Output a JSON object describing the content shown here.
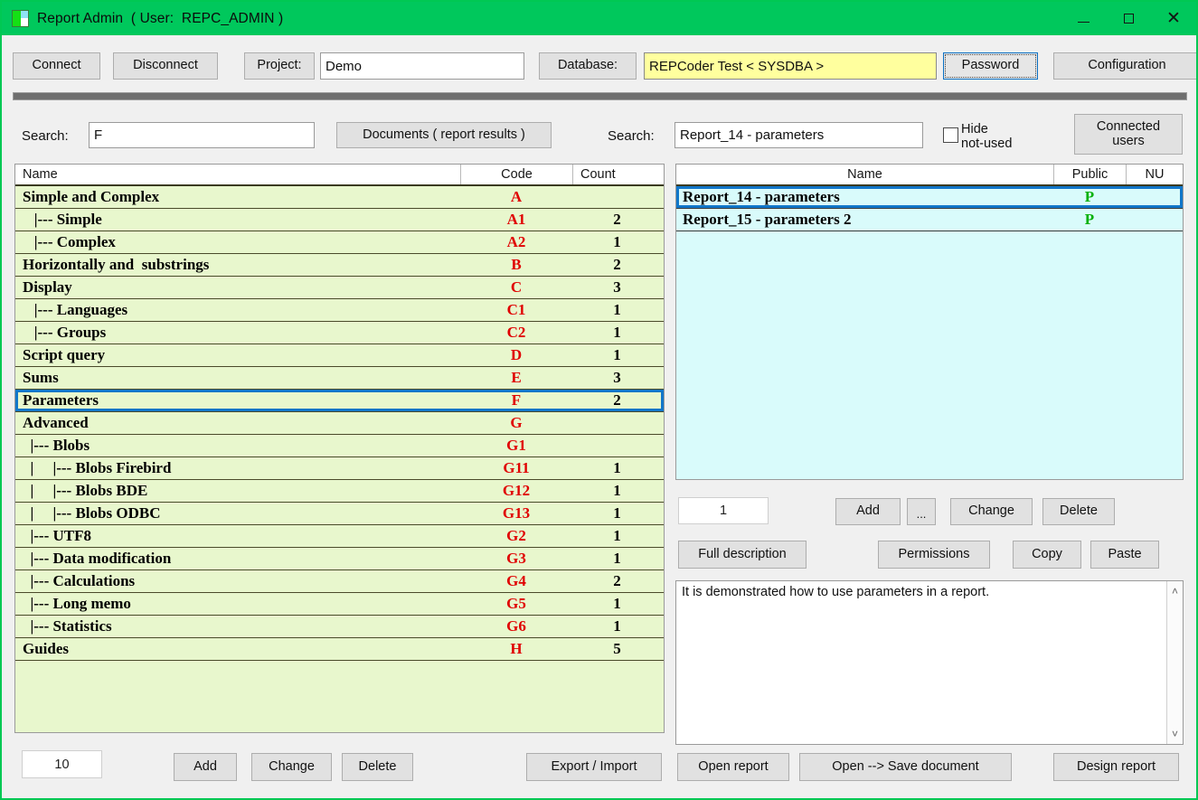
{
  "window": {
    "title": "Report Admin  ( User:  REPC_ADMIN )",
    "icon": "app-grid-icon",
    "minimize": "",
    "maximize": "",
    "close": "✕",
    "titlebar_color": "#00c85c"
  },
  "toolbar": {
    "connect": "Connect",
    "disconnect": "Disconnect",
    "project_label": "Project:",
    "project_value": "Demo",
    "database_label": "Database:",
    "database_value": "REPCoder Test < SYSDBA >",
    "password": "Password",
    "configuration": "Configuration"
  },
  "left": {
    "search_label": "Search:",
    "search_value": "F",
    "documents_button": "Documents ( report results )",
    "columns": [
      "Name",
      "Code",
      "Count"
    ],
    "sort_indicator": "ˇ",
    "rows": [
      {
        "name": "Simple and Complex",
        "code": "A",
        "count": "",
        "selected": false
      },
      {
        "name": "   |--- Simple",
        "code": "A1",
        "count": "2",
        "selected": false
      },
      {
        "name": "   |--- Complex",
        "code": "A2",
        "count": "1",
        "selected": false
      },
      {
        "name": "Horizontally and  substrings",
        "code": "B",
        "count": "2",
        "selected": false
      },
      {
        "name": "Display",
        "code": "C",
        "count": "3",
        "selected": false
      },
      {
        "name": "   |--- Languages",
        "code": "C1",
        "count": "1",
        "selected": false
      },
      {
        "name": "   |--- Groups",
        "code": "C2",
        "count": "1",
        "selected": false
      },
      {
        "name": "Script query",
        "code": "D",
        "count": "1",
        "selected": false
      },
      {
        "name": "Sums",
        "code": "E",
        "count": "3",
        "selected": false
      },
      {
        "name": "Parameters",
        "code": "F",
        "count": "2",
        "selected": true
      },
      {
        "name": "Advanced",
        "code": "G",
        "count": "",
        "selected": false
      },
      {
        "name": "  |--- Blobs",
        "code": "G1",
        "count": "",
        "selected": false
      },
      {
        "name": "  |     |--- Blobs Firebird",
        "code": "G11",
        "count": "1",
        "selected": false
      },
      {
        "name": "  |     |--- Blobs BDE",
        "code": "G12",
        "count": "1",
        "selected": false
      },
      {
        "name": "  |     |--- Blobs ODBC",
        "code": "G13",
        "count": "1",
        "selected": false
      },
      {
        "name": "  |--- UTF8",
        "code": "G2",
        "count": "1",
        "selected": false
      },
      {
        "name": "  |--- Data modification",
        "code": "G3",
        "count": "1",
        "selected": false
      },
      {
        "name": "  |--- Calculations",
        "code": "G4",
        "count": "2",
        "selected": false
      },
      {
        "name": "  |--- Long memo",
        "code": "G5",
        "count": "1",
        "selected": false
      },
      {
        "name": "  |--- Statistics",
        "code": "G6",
        "count": "1",
        "selected": false
      },
      {
        "name": "Guides",
        "code": "H",
        "count": "5",
        "selected": false
      }
    ],
    "count_value": "10",
    "add": "Add",
    "change": "Change",
    "delete": "Delete",
    "export_import": "Export / Import"
  },
  "right": {
    "search_label": "Search:",
    "search_value": "Report_14 - parameters",
    "hide_notused_label": "Hide\nnot-used",
    "hide_notused_checked": false,
    "connected_users": "Connected\nusers",
    "columns": [
      "Name",
      "Public",
      "NU"
    ],
    "sort_indicator": "ˇ",
    "rows": [
      {
        "name": "Report_14 - parameters",
        "public": "P",
        "nu": "",
        "selected": true
      },
      {
        "name": "Report_15 - parameters 2",
        "public": "P",
        "nu": "",
        "selected": false
      }
    ],
    "count_value": "1",
    "add": "Add",
    "ellipsis": "...",
    "change": "Change",
    "delete": "Delete",
    "full_description": "Full description",
    "permissions": "Permissions",
    "copy": "Copy",
    "paste": "Paste",
    "description_text": "It is demonstrated how to use parameters in a report.",
    "scroll_up": "˄",
    "scroll_down": "˅",
    "open_report": "Open report",
    "open_save_document": "Open --> Save document",
    "design_report": "Design report"
  },
  "colors": {
    "accent_green": "#00c85c",
    "left_list_bg": "#e8f7cd",
    "right_list_bg": "#d9fbfb",
    "code_red": "#e00000",
    "public_green": "#00b000",
    "selection_blue": "#1176c9",
    "database_yellow": "#ffff9e"
  }
}
